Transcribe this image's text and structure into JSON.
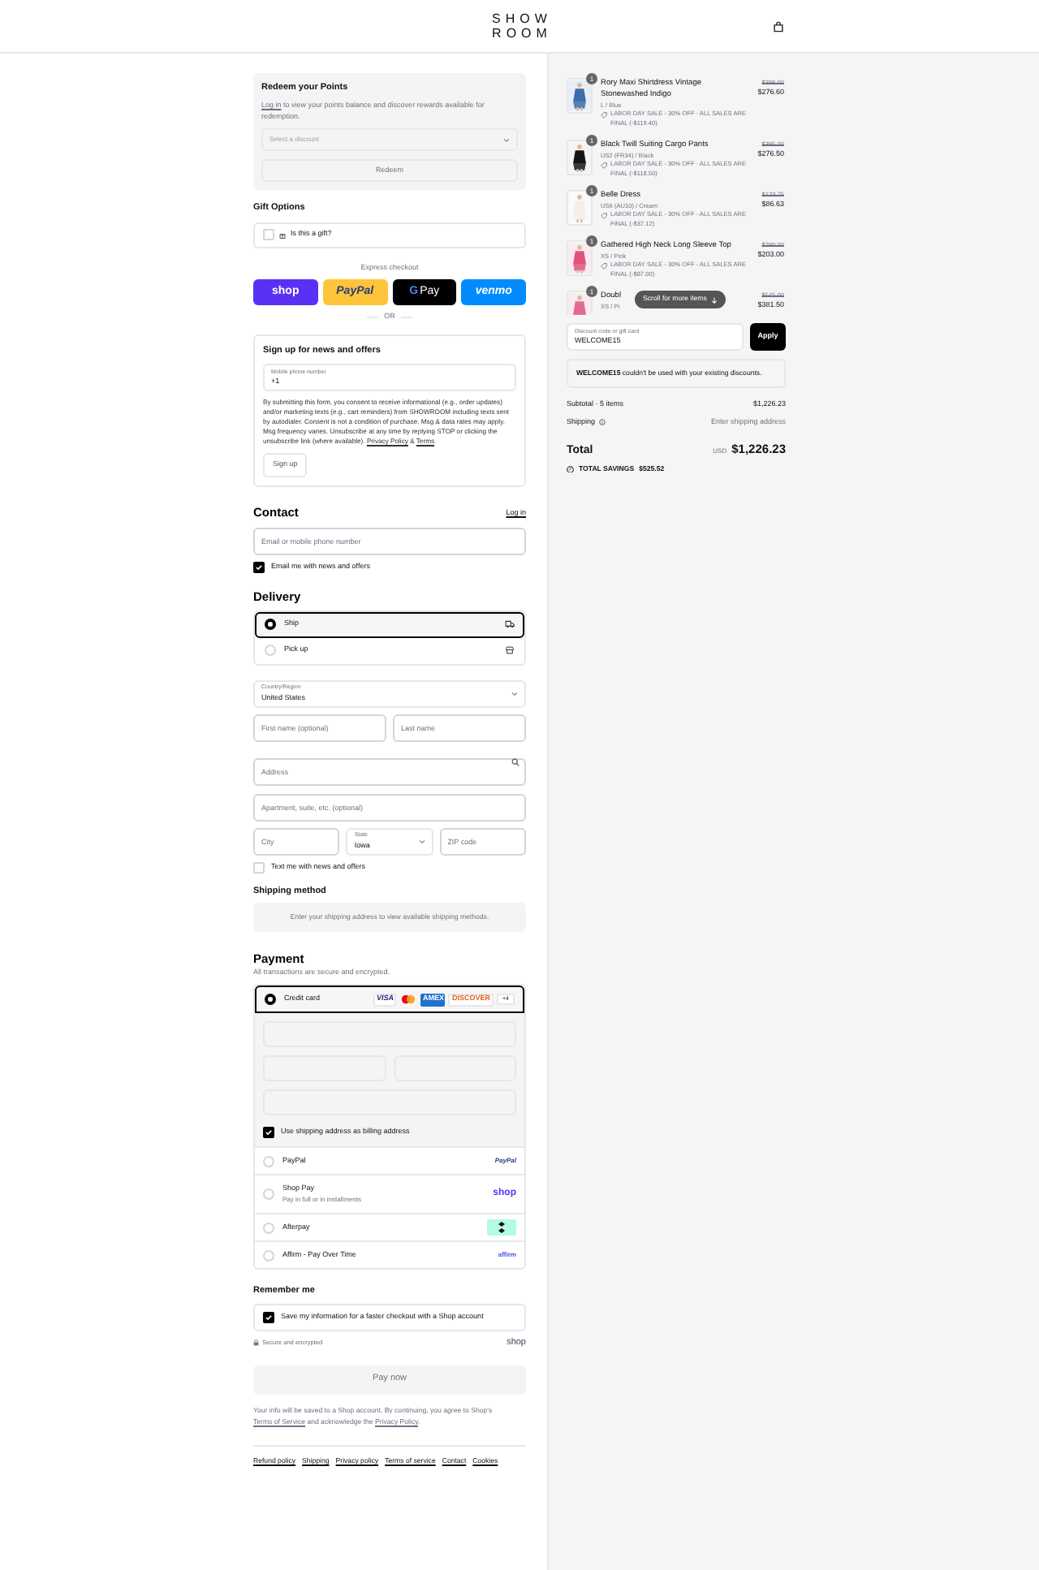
{
  "header": {
    "logo_lines": [
      "SHOW",
      "ROOM"
    ]
  },
  "points": {
    "title": "Redeem your Points",
    "login_link": "Log in",
    "text": " to view your points balance and discover rewards available for redemption.",
    "select_placeholder": "Select a discount",
    "button": "Redeem"
  },
  "gift": {
    "title": "Gift Options",
    "label": "Is this a gift?",
    "checked": false
  },
  "express": {
    "label": "Express checkout",
    "buttons": [
      {
        "kind": "shop",
        "label": "shop"
      },
      {
        "kind": "paypal",
        "label": "PayPal"
      },
      {
        "kind": "gpay",
        "mark": "G",
        "label": "Pay"
      },
      {
        "kind": "venmo",
        "label": "venmo"
      }
    ],
    "divider": "OR"
  },
  "signup": {
    "title": "Sign up for news and offers",
    "phone_label": "Mobile phone number",
    "phone_value": "+1",
    "legal": "By submitting this form, you consent to receive informational (e.g., order updates) and/or marketing texts (e.g., cart reminders) from SHOWROOM including texts sent by autodialer. Consent is not a condition of purchase. Msg & data rates may apply. Msg frequency varies. Unsubscribe at any time by replying STOP or clicking the unsubscribe link (where available).",
    "links": [
      "Privacy Policy",
      "Terms"
    ],
    "joiner": "&",
    "end": ".",
    "button": "Sign up"
  },
  "contact": {
    "title": "Contact",
    "login": "Log in",
    "email_placeholder": "Email or mobile phone number",
    "news_label": "Email me with news and offers",
    "news_checked": true
  },
  "delivery": {
    "title": "Delivery",
    "options": [
      {
        "kind": "ship",
        "label": "Ship",
        "selected": true
      },
      {
        "kind": "pickup",
        "label": "Pick up",
        "selected": false
      }
    ],
    "country_label": "Country/Region",
    "country": "United States",
    "first_placeholder": "First name (optional)",
    "last_placeholder": "Last name",
    "address_placeholder": "Address",
    "apartment_placeholder": "Apartment, suite, etc. (optional)",
    "city_placeholder": "City",
    "state_label": "State",
    "state": "Iowa",
    "zip_placeholder": "ZIP code",
    "sms_label": "Text me with news and offers",
    "sms_checked": false
  },
  "shipping_method": {
    "title": "Shipping method",
    "notice": "Enter your shipping address to view available shipping methods."
  },
  "payment": {
    "title": "Payment",
    "subtitle": "All transactions are secure and encrypted.",
    "billing_label": "Use shipping address as billing address",
    "billing_checked": true,
    "methods": [
      {
        "kind": "card",
        "label": "Credit card",
        "selected": true,
        "brands": [
          {
            "kind": "visa",
            "label": "VISA"
          },
          {
            "kind": "mastercard"
          },
          {
            "kind": "amex",
            "label": "AMEX"
          },
          {
            "kind": "discover",
            "label": "DISCOVER"
          },
          {
            "kind": "more",
            "label": "+4"
          }
        ]
      },
      {
        "kind": "paypal",
        "label": "PayPal",
        "logo": "PayPal",
        "selected": false
      },
      {
        "kind": "shoppay",
        "label": "Shop Pay",
        "sublabel": "Pay in full or in installments",
        "logo": "shop",
        "selected": false
      },
      {
        "kind": "afterpay",
        "label": "Afterpay",
        "selected": false
      },
      {
        "kind": "affirm",
        "label": "Affirm - Pay Over Time",
        "logo": "affirm",
        "selected": false
      }
    ]
  },
  "remember": {
    "title": "Remember me",
    "label": "Save my information for a faster checkout with a Shop account",
    "checked": true,
    "secure": "Secure and encrypted",
    "logo": "shop"
  },
  "pay_button": "Pay now",
  "disclaimer": {
    "before": "Your info will be saved to a Shop account. By continuing, you agree to Shop's ",
    "link1": "Terms of Service",
    "middle": " and acknowledge the ",
    "link2": "Privacy Policy",
    "after": "."
  },
  "footer_links": [
    "Refund policy",
    "Shipping",
    "Privacy policy",
    "Terms of service",
    "Contact",
    "Cookies"
  ],
  "summary": {
    "items": [
      {
        "quantity": "1",
        "name": "Rory Maxi Shirtdress Vintage Stonewashed Indigo",
        "variant": "L / Blue",
        "discount": "LABOR DAY SALE - 30% OFF - ALL SALES ARE FINAL (-$119.40)",
        "original": "$396.00",
        "price": "$276.60"
      },
      {
        "quantity": "1",
        "name": "Black Twill Suiting Cargo Pants",
        "variant": "US2 (FR34) / Black",
        "discount": "LABOR DAY SALE - 30% OFF - ALL SALES ARE FINAL (-$118.50)",
        "original": "$395.00",
        "price": "$276.50"
      },
      {
        "quantity": "1",
        "name": "Belle Dress",
        "variant": "US6 (AU10) / Cream",
        "discount": "LABOR DAY SALE - 30% OFF - ALL SALES ARE FINAL (-$37.12)",
        "original": "$123.75",
        "price": "$86.63"
      },
      {
        "quantity": "1",
        "name": "Gathered High Neck Long Sleeve Top",
        "variant": "XS / Pink",
        "discount": "LABOR DAY SALE - 30% OFF - ALL SALES ARE FINAL (-$87.00)",
        "original": "$290.00",
        "price": "$203.00"
      },
      {
        "quantity": "1",
        "name": "Doubl",
        "variant": "XS / Pi",
        "original": "$545.00",
        "price": "$381.50"
      }
    ],
    "scroll_hint": "Scroll for more items",
    "discount_label": "Discount code or gift card",
    "discount_value": "WELCOME15",
    "apply": "Apply",
    "message": "**WELCOME15** couldn't be used with your existing discounts.",
    "subtotal_label": "Subtotal · 5 items",
    "subtotal": "$1,226.23",
    "shipping_label": "Shipping",
    "shipping_value": "Enter shipping address",
    "total_label": "Total",
    "currency": "USD",
    "total": "$1,226.23",
    "savings_label": "TOTAL SAVINGS",
    "savings": "$525.52"
  }
}
